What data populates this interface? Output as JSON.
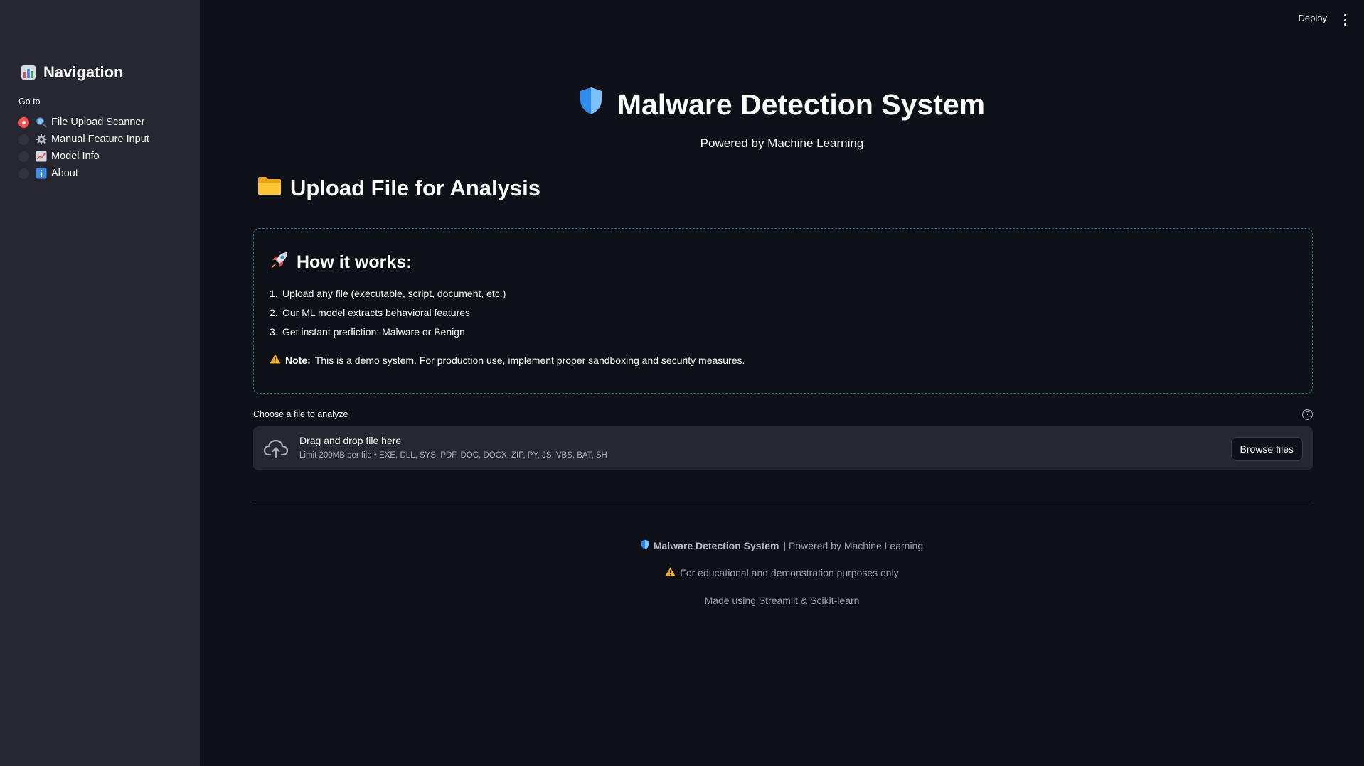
{
  "header": {
    "deploy_label": "Deploy",
    "menu_icon": "kebab-menu-icon"
  },
  "sidebar": {
    "title": "Navigation",
    "title_icon": "bar-chart-icon",
    "radio_label": "Go to",
    "items": [
      {
        "label": "File Upload Scanner",
        "icon": "magnifier-icon",
        "selected": true
      },
      {
        "label": "Manual Feature Input",
        "icon": "gear-icon",
        "selected": false
      },
      {
        "label": "Model Info",
        "icon": "line-chart-icon",
        "selected": false
      },
      {
        "label": "About",
        "icon": "info-icon",
        "selected": false
      }
    ]
  },
  "main": {
    "title": "Malware Detection System",
    "title_icon": "shield-icon",
    "subtitle": "Powered by Machine Learning",
    "section_title": "Upload File for Analysis",
    "section_icon": "folder-icon",
    "how_it_works": {
      "title": "How it works:",
      "icon": "rocket-icon",
      "steps": [
        {
          "num": "1.",
          "text": "Upload any file (executable, script, document, etc.)"
        },
        {
          "num": "2.",
          "text": "Our ML model extracts behavioral features"
        },
        {
          "num": "3.",
          "text": "Get instant prediction: Malware or Benign"
        }
      ],
      "note_label": "Note:",
      "note_text": "This is a demo system. For production use, implement proper sandboxing and security measures."
    },
    "uploader": {
      "label": "Choose a file to analyze",
      "help_icon": "?",
      "drop_title": "Drag and drop file here",
      "limit_text": "Limit 200MB per file • EXE, DLL, SYS, PDF, DOC, DOCX, ZIP, PY, JS, VBS, BAT, SH",
      "browse_label": "Browse files"
    }
  },
  "footer": {
    "brand": "Malware Detection System",
    "powered": "| Powered by Machine Learning",
    "disclaimer": "For educational and demonstration purposes only",
    "made_with": "Made using Streamlit & Scikit-learn"
  },
  "colors": {
    "background": "#0e1117",
    "sidebar": "#262730",
    "accent": "#ff4b4b",
    "shield": "#2e8bf0",
    "warning": "#f5b020"
  }
}
